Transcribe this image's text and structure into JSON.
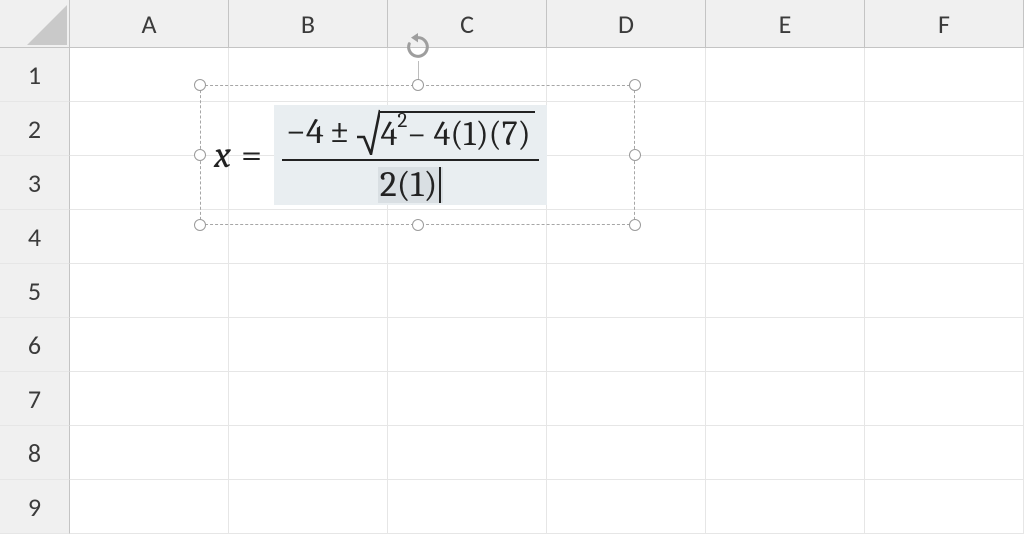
{
  "grid": {
    "columns": [
      "A",
      "B",
      "C",
      "D",
      "E",
      "F"
    ],
    "rows": [
      "1",
      "2",
      "3",
      "4",
      "5",
      "6",
      "7",
      "8",
      "9"
    ]
  },
  "equation": {
    "variable": "x",
    "equals": "=",
    "plus_minus": "±",
    "numerator": {
      "leading": "−4 ",
      "sqrt_inner_base": "4",
      "sqrt_inner_exp": "2",
      "sqrt_inner_rest": " − 4(1)(7)"
    },
    "denominator": "2(1)"
  }
}
